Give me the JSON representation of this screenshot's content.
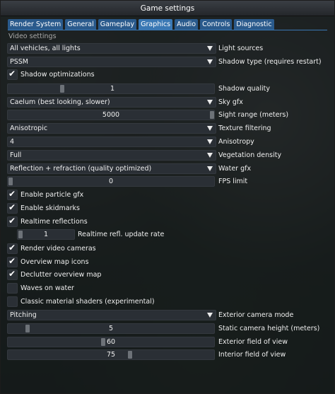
{
  "window": {
    "title": "Game settings"
  },
  "tabs": [
    {
      "label": "Render System",
      "active": false
    },
    {
      "label": "General",
      "active": false
    },
    {
      "label": "Gameplay",
      "active": false
    },
    {
      "label": "Graphics",
      "active": true
    },
    {
      "label": "Audio",
      "active": false
    },
    {
      "label": "Controls",
      "active": false
    },
    {
      "label": "Diagnostic",
      "active": false
    }
  ],
  "section": {
    "label": "Video settings"
  },
  "settings": {
    "light_sources": {
      "value": "All vehicles, all lights",
      "label": "Light sources"
    },
    "shadow_type": {
      "value": "PSSM",
      "label": "Shadow type (requires restart)"
    },
    "shadow_optimizations": {
      "label": "Shadow optimizations",
      "checked": true
    },
    "shadow_quality": {
      "value": "1",
      "label": "Shadow quality",
      "level": 0.33
    },
    "sky_gfx": {
      "value": "Caelum (best looking, slower)",
      "label": "Sky gfx"
    },
    "sight_range": {
      "value": "5000",
      "label": "Sight range (meters)",
      "level": 1.0
    },
    "texture_filtering": {
      "value": "Anisotropic",
      "label": "Texture filtering"
    },
    "anisotropy": {
      "value": "4",
      "label": "Anisotropy"
    },
    "vegetation_density": {
      "value": "Full",
      "label": "Vegetation density"
    },
    "water_gfx": {
      "value": "Reflection + refraction (quality optimized)",
      "label": "Water gfx"
    },
    "fps_limit": {
      "value": "0",
      "label": "FPS limit",
      "level": 0.0
    },
    "particle_gfx": {
      "label": "Enable particle gfx",
      "checked": true
    },
    "skidmarks": {
      "label": "Enable skidmarks",
      "checked": true
    },
    "realtime_reflections": {
      "label": "Realtime reflections",
      "checked": true
    },
    "refl_update_rate": {
      "value": "1",
      "label": "Realtime refl. update rate",
      "level": 0.0
    },
    "video_cameras": {
      "label": "Render video cameras",
      "checked": true
    },
    "overview_map_icons": {
      "label": "Overview map icons",
      "checked": true
    },
    "declutter_overview_map": {
      "label": "Declutter overview map",
      "checked": true
    },
    "waves_on_water": {
      "label": "Waves on water",
      "checked": false
    },
    "classic_material_shaders": {
      "label": "Classic material shaders (experimental)",
      "checked": false
    },
    "exterior_camera_mode": {
      "value": "Pitching",
      "label": "Exterior camera mode"
    },
    "static_camera_height": {
      "value": "5",
      "label": "Static camera height (meters)",
      "level": 0.1
    },
    "exterior_fov": {
      "value": "60",
      "label": "Exterior field of view",
      "level": 0.46
    },
    "interior_fov": {
      "value": "75",
      "label": "Interior field of view",
      "level": 0.58
    }
  },
  "icons": {
    "check": "checkmark-icon",
    "dropdown": "triangle-down-icon"
  },
  "colors": {
    "tab": "#2a5a8c",
    "tab_active": "#3a78b4",
    "panel": "#12161a",
    "check": "#ffffff"
  }
}
